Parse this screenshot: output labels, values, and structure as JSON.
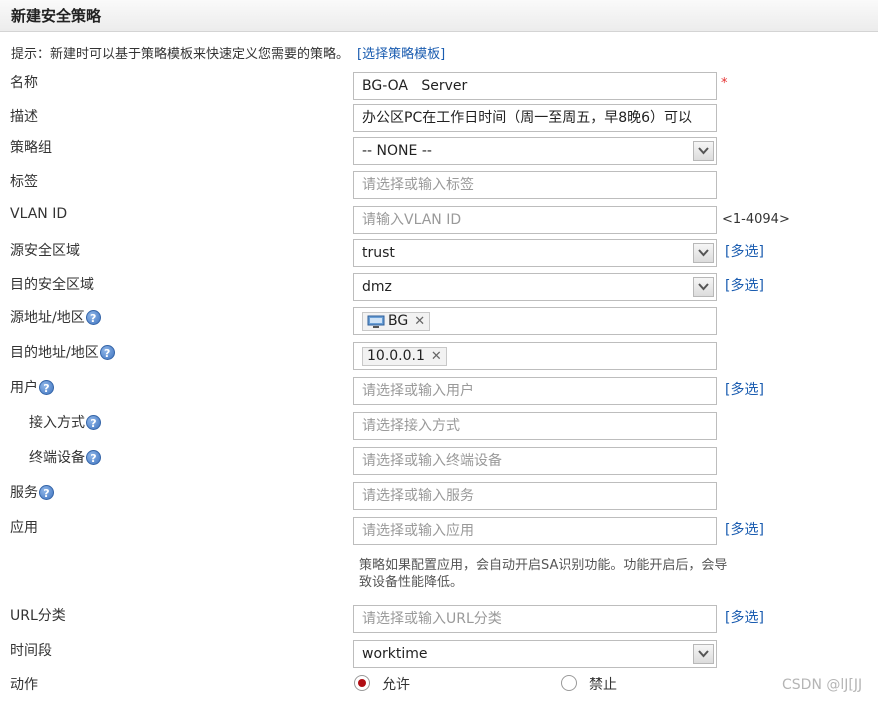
{
  "window": {
    "title": "新建安全策略"
  },
  "hint": {
    "text": "提示：新建时可以基于策略模板来快速定义您需要的策略。",
    "link": "[选择策略模板]"
  },
  "form": {
    "name": {
      "label": "名称",
      "value": "BG-OA   Server",
      "required": "*"
    },
    "description": {
      "label": "描述",
      "value": "办公区PC在工作日时间（周一至周五，早8晚6）可以"
    },
    "group": {
      "label": "策略组",
      "value": "-- NONE --"
    },
    "tags": {
      "label": "标签",
      "placeholder": "请选择或输入标签"
    },
    "vlan": {
      "label": "VLAN ID",
      "placeholder": "请输入VLAN ID",
      "range": "<1-4094>"
    },
    "src_zone": {
      "label": "源安全区域",
      "value": "trust",
      "multi": "[多选]"
    },
    "dst_zone": {
      "label": "目的安全区域",
      "value": "dmz",
      "multi": "[多选]"
    },
    "src_addr": {
      "label": "源地址/地区",
      "tag": "BG",
      "tag_icon": "computer-icon"
    },
    "dst_addr": {
      "label": "目的地址/地区",
      "tag": "10.0.0.1"
    },
    "user": {
      "label": "用户",
      "placeholder": "请选择或输入用户",
      "multi": "[多选]"
    },
    "access": {
      "label": "接入方式",
      "placeholder": "请选择接入方式"
    },
    "terminal": {
      "label": "终端设备",
      "placeholder": "请选择或输入终端设备"
    },
    "service": {
      "label": "服务",
      "placeholder": "请选择或输入服务"
    },
    "application": {
      "label": "应用",
      "placeholder": "请选择或输入应用",
      "multi": "[多选]",
      "note": "策略如果配置应用，会自动开启SA识别功能。功能开启后，会导致设备性能降低。"
    },
    "url": {
      "label": "URL分类",
      "placeholder": "请选择或输入URL分类",
      "multi": "[多选]"
    },
    "schedule": {
      "label": "时间段",
      "value": "worktime"
    },
    "action": {
      "label": "动作",
      "allow": "允许",
      "deny": "禁止",
      "selected": "允许"
    }
  },
  "help_glyph": "?",
  "tag_remove_glyph": "✕",
  "watermark": "CSDN @lJ[JJ",
  "colors": {
    "link": "#1a5cb0",
    "required": "#e53030",
    "radio_selected": "#b00e14"
  }
}
